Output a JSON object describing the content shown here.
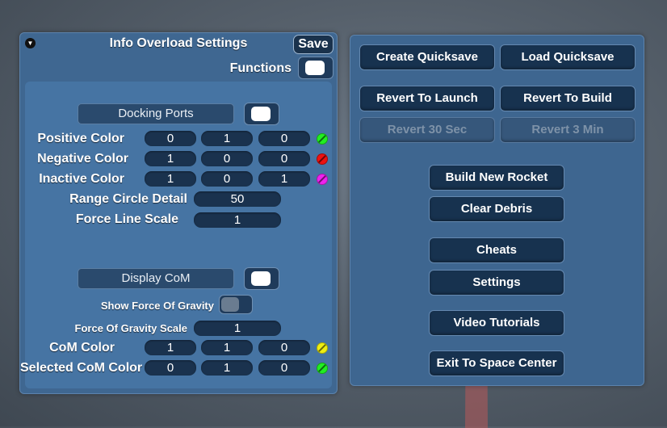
{
  "left_panel": {
    "title": "Info Overload Settings",
    "save_label": "Save",
    "functions_label": "Functions",
    "docking_section": {
      "button_label": "Docking Ports",
      "rows": [
        {
          "label": "Positive Color",
          "values": [
            "0",
            "1",
            "0"
          ],
          "swatch": "#22ee22"
        },
        {
          "label": "Negative Color",
          "values": [
            "1",
            "0",
            "0"
          ],
          "swatch": "#ee1111"
        },
        {
          "label": "Inactive Color",
          "values": [
            "1",
            "0",
            "1"
          ],
          "swatch": "#ee22ee"
        }
      ],
      "range_circle_label": "Range Circle Detail",
      "range_circle_value": "50",
      "force_line_label": "Force Line Scale",
      "force_line_value": "1"
    },
    "com_section": {
      "button_label": "Display CoM",
      "show_gravity_label": "Show Force Of Gravity",
      "gravity_scale_label": "Force Of Gravity Scale",
      "gravity_scale_value": "1",
      "rows": [
        {
          "label": "CoM Color",
          "values": [
            "1",
            "1",
            "0"
          ],
          "swatch": "#eeee11"
        },
        {
          "label": "Selected CoM Color",
          "values": [
            "0",
            "1",
            "0"
          ],
          "swatch": "#22ee22"
        }
      ]
    }
  },
  "right_panel": {
    "buttons": {
      "create_quicksave": "Create Quicksave",
      "load_quicksave": "Load Quicksave",
      "revert_launch": "Revert To Launch",
      "revert_build": "Revert To Build",
      "revert_30": "Revert 30 Sec",
      "revert_3min": "Revert 3 Min",
      "build_new_rocket": "Build New Rocket",
      "clear_debris": "Clear Debris",
      "cheats": "Cheats",
      "settings": "Settings",
      "video_tutorials": "Video Tutorials",
      "exit_space_center": "Exit To Space Center"
    }
  },
  "colors": {
    "panel": "#3f6791",
    "inner_panel": "#4674a3",
    "button": "#17324f",
    "field": "#1a324e"
  }
}
